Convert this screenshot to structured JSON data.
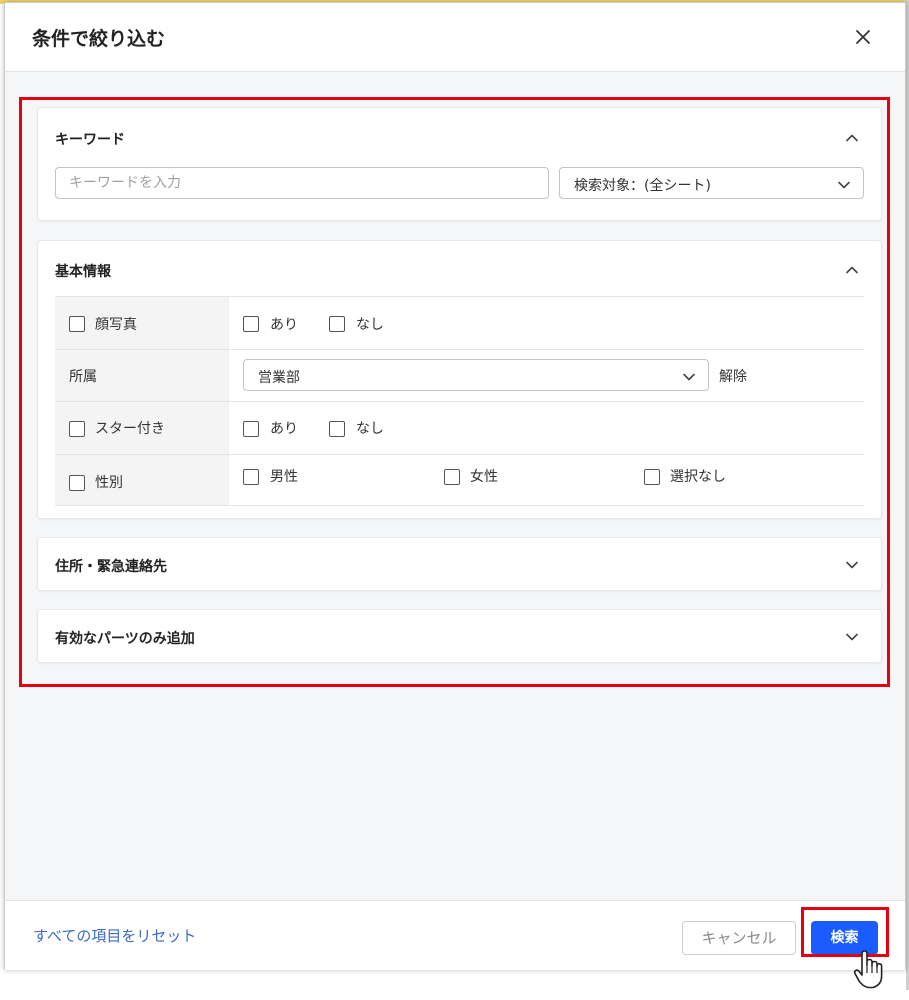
{
  "dialog": {
    "title": "条件で絞り込む",
    "close_icon": "close-icon"
  },
  "keyword_panel": {
    "title": "キーワード",
    "input_placeholder": "キーワードを入力",
    "input_value": "",
    "target_select": "検索対象：(全シート)",
    "expanded": true
  },
  "basic_panel": {
    "title": "基本情報",
    "expanded": true,
    "rows": [
      {
        "label": "顔写真",
        "label_checkbox": true,
        "options": [
          "あり",
          "なし"
        ]
      },
      {
        "label": "所属",
        "label_checkbox": false,
        "select_value": "営業部",
        "clear_label": "解除"
      },
      {
        "label": "スター付き",
        "label_checkbox": true,
        "options": [
          "あり",
          "なし"
        ]
      },
      {
        "label": "性別",
        "label_checkbox": true,
        "options": [
          "男性",
          "女性",
          "選択なし"
        ]
      }
    ]
  },
  "address_panel": {
    "title": "住所・緊急連絡先",
    "expanded": false
  },
  "parts_panel": {
    "title": "有効なパーツのみ追加",
    "expanded": false
  },
  "footer": {
    "reset_link": "すべての項目をリセット",
    "cancel_label": "キャンセル",
    "search_label": "検索"
  },
  "colors": {
    "highlight": "#e60012",
    "primary_button": "#1a5cff",
    "link": "#3d6bc7"
  }
}
